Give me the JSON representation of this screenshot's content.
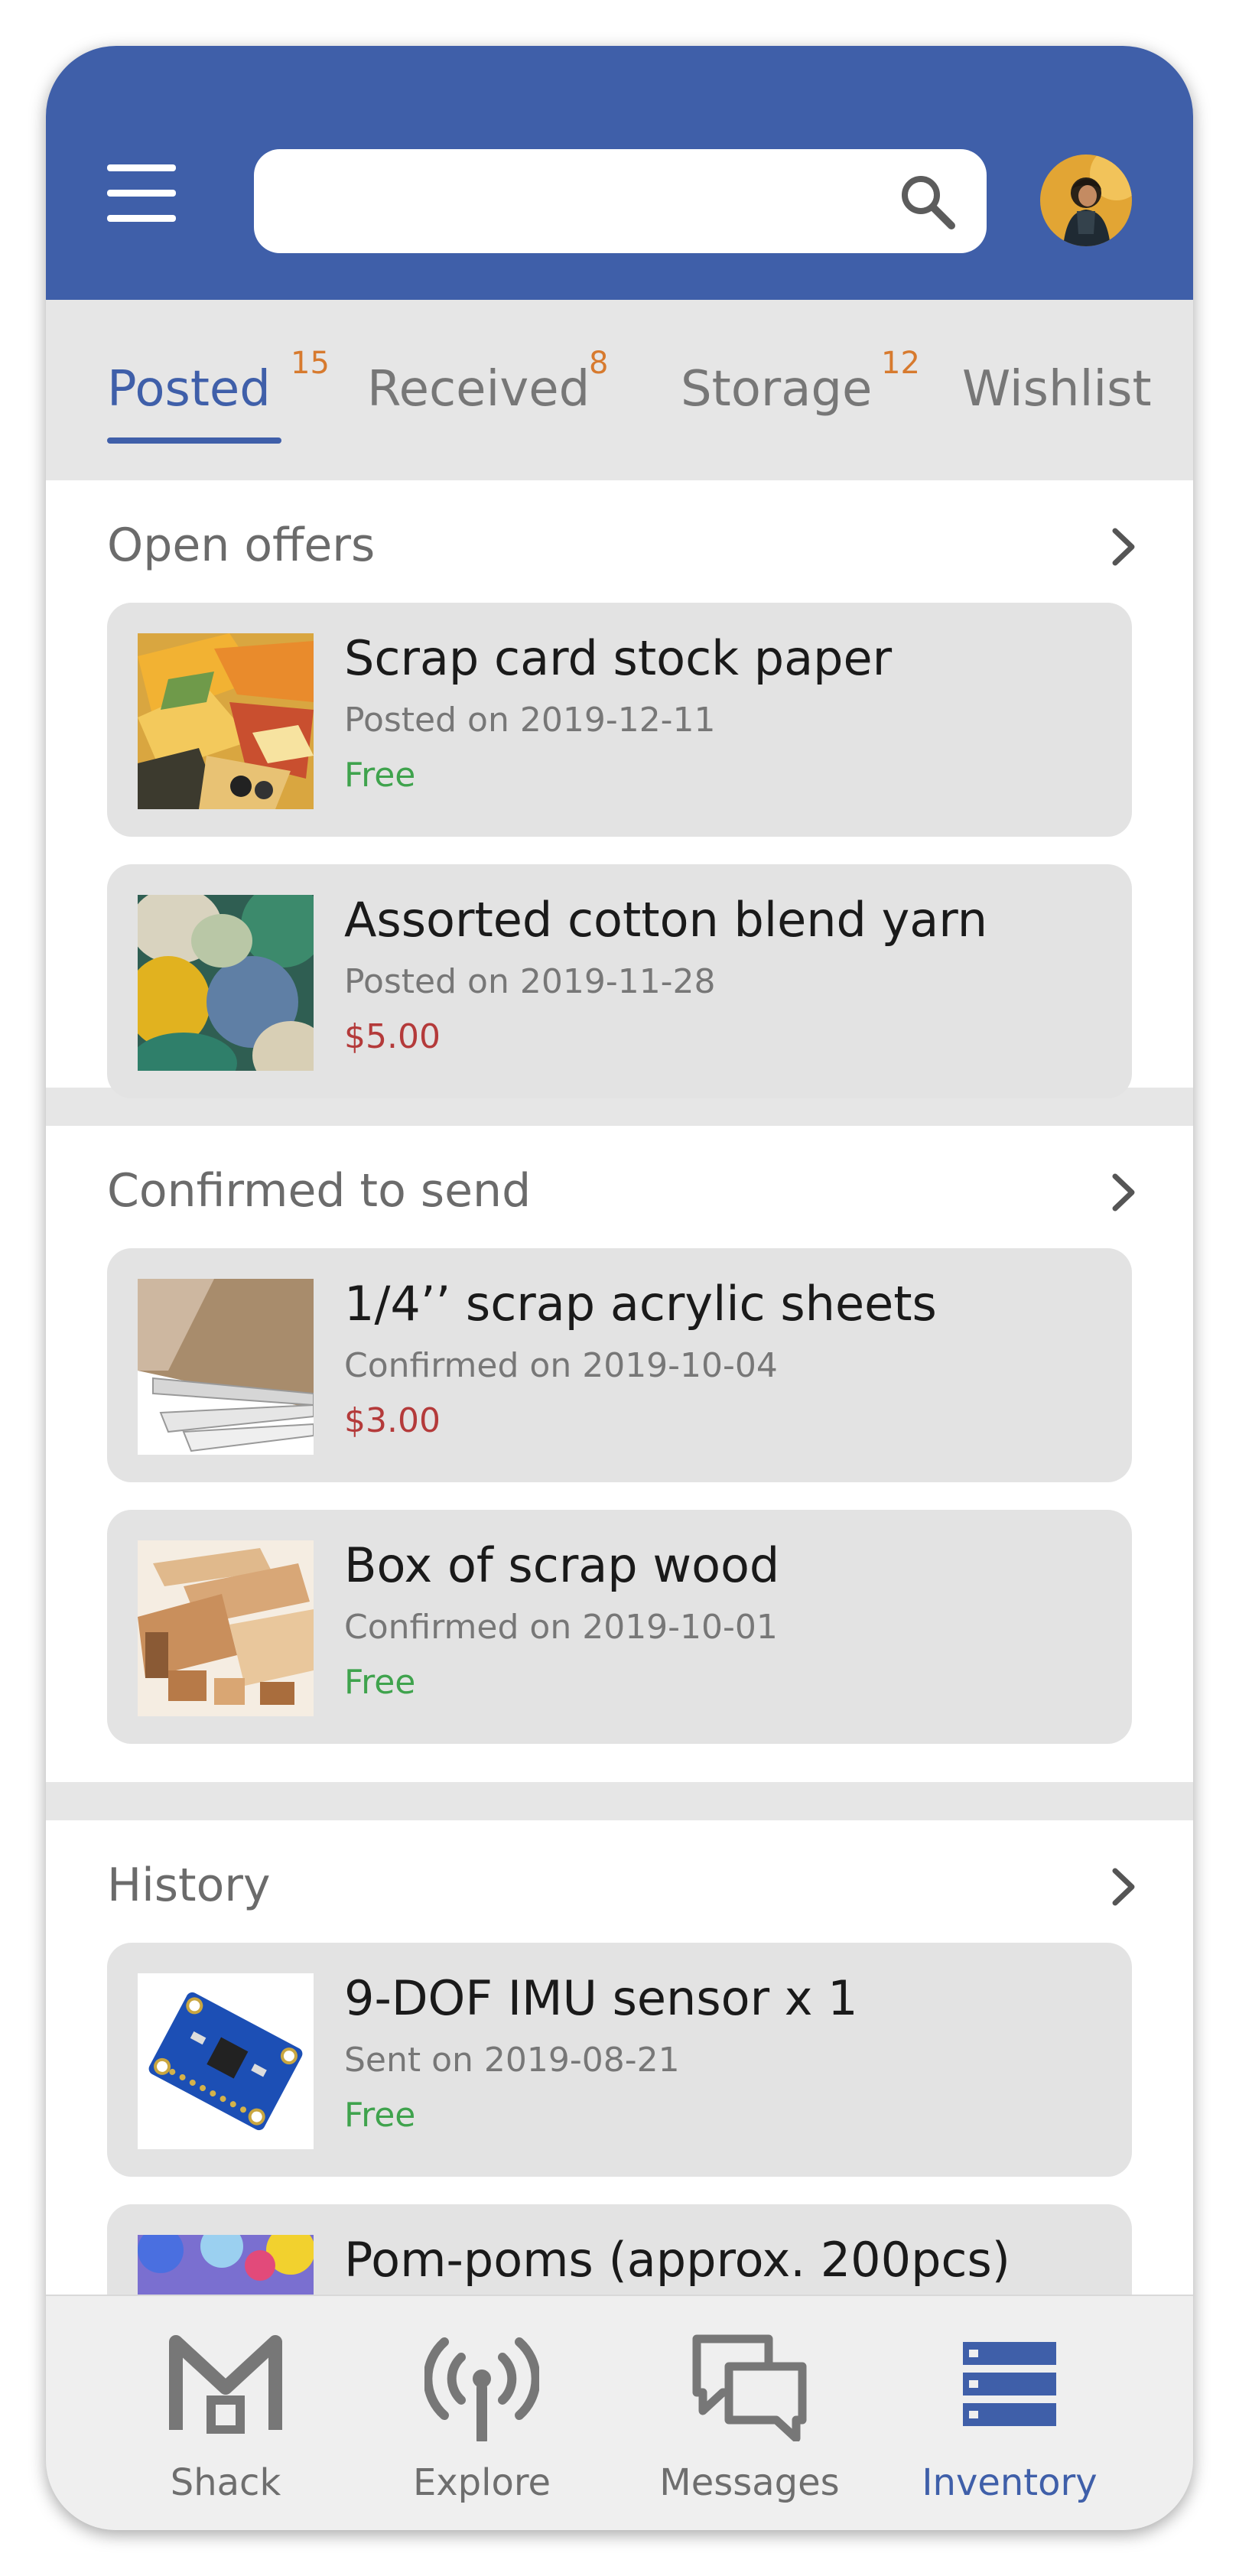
{
  "header": {
    "search_placeholder": "",
    "search_value": ""
  },
  "tabs": [
    {
      "label": "Posted",
      "count": "15",
      "active": true
    },
    {
      "label": "Received",
      "count": "8",
      "active": false
    },
    {
      "label": "Storage",
      "count": "12",
      "active": false
    },
    {
      "label": "Wishlist",
      "count": "",
      "active": false
    }
  ],
  "sections": {
    "open_offers": {
      "title": "Open offers",
      "items": [
        {
          "title": "Scrap card stock paper",
          "subtitle": "Posted on 2019-12-11",
          "price": "Free"
        },
        {
          "title": "Assorted cotton blend yarn",
          "subtitle": "Posted on 2019-11-28",
          "price": "$5.00"
        }
      ]
    },
    "confirmed": {
      "title": "Confirmed to send",
      "items": [
        {
          "title": "1/4’’ scrap acrylic sheets",
          "subtitle": "Confirmed on 2019-10-04",
          "price": "$3.00"
        },
        {
          "title": "Box of scrap wood",
          "subtitle": "Confirmed on 2019-10-01",
          "price": "Free"
        }
      ]
    },
    "history": {
      "title": "History",
      "items": [
        {
          "title": "9-DOF IMU sensor x 1",
          "subtitle": "Sent on 2019-08-21",
          "price": "Free"
        },
        {
          "title": "Pom-poms (approx. 200pcs)",
          "subtitle": "",
          "price": ""
        }
      ]
    }
  },
  "bottom_nav": [
    {
      "label": "Shack",
      "icon": "shack-icon",
      "active": false
    },
    {
      "label": "Explore",
      "icon": "antenna-icon",
      "active": false
    },
    {
      "label": "Messages",
      "icon": "messages-icon",
      "active": false
    },
    {
      "label": "Inventory",
      "icon": "inventory-icon",
      "active": true
    }
  ],
  "colors": {
    "brand": "#3f5fa9",
    "free": "#3fa34d",
    "paid": "#b43a3a",
    "badge": "#d77a2e"
  }
}
